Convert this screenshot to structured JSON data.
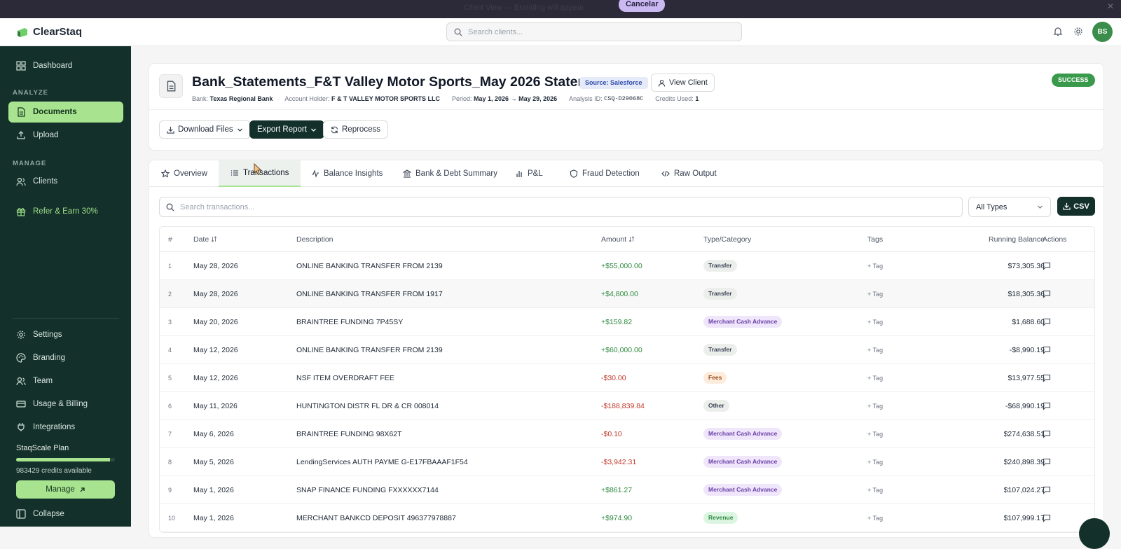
{
  "banner": {
    "message": "Client View — Branding will appear",
    "cancel_label": "Cancelar",
    "close": "✕"
  },
  "app": {
    "name": "ClearStaq",
    "search_placeholder": "Search clients...",
    "avatar_initials": "BS"
  },
  "sidebar": {
    "items": [
      {
        "label": "Dashboard",
        "icon": "grid-icon"
      }
    ],
    "analyze_label": "ANALYZE",
    "analyze_items": [
      {
        "label": "Documents",
        "icon": "document-icon",
        "active": true
      },
      {
        "label": "Upload",
        "icon": "upload-icon"
      }
    ],
    "manage_label": "MANAGE",
    "manage_items": [
      {
        "label": "Clients",
        "icon": "users-icon"
      }
    ],
    "refer_label": "Refer & Earn 30%",
    "bottom_items": [
      {
        "label": "Settings",
        "icon": "gear-icon"
      },
      {
        "label": "Branding",
        "icon": "palette-icon"
      },
      {
        "label": "Team",
        "icon": "team-icon"
      },
      {
        "label": "Usage & Billing",
        "icon": "card-icon"
      },
      {
        "label": "Integrations",
        "icon": "plug-icon"
      }
    ],
    "plan_name": "StaqScale Plan",
    "plan_usage": 0.95,
    "credits": "983429 credits available",
    "manage_label_btn": "Manage",
    "collapse_label": "Collapse"
  },
  "document": {
    "title": "Bank_Statements_F&T Valley Motor Sports_May 2026 Statement",
    "source": "Source: Salesforce",
    "view_client": "View Client",
    "status": "SUCCESS",
    "meta": {
      "bank_label": "Bank:",
      "bank": "Texas Regional Bank",
      "holder_label": "Account Holder:",
      "holder": "F & T VALLEY MOTOR SPORTS LLC",
      "period_label": "Period:",
      "period": "May 1, 2026 → May 29, 2026",
      "analysis_label": "Analysis ID:",
      "analysis_id": "CSQ-D29068C",
      "credits_label": "Credits Used:",
      "credits": "1"
    },
    "actions": {
      "download": "Download Files",
      "export": "Export Report",
      "reprocess": "Reprocess"
    }
  },
  "tabs": [
    {
      "label": "Overview",
      "icon": "star-icon"
    },
    {
      "label": "Transactions",
      "icon": "list-icon",
      "active": true
    },
    {
      "label": "Balance Insights",
      "icon": "activity-icon"
    },
    {
      "label": "Bank & Debt Summary",
      "icon": "bank-icon"
    },
    {
      "label": "P&L",
      "icon": "bar-chart-icon"
    },
    {
      "label": "Fraud Detection",
      "icon": "shield-icon"
    },
    {
      "label": "Raw Output",
      "icon": "code-icon"
    }
  ],
  "transactions": {
    "search_placeholder": "Search transactions...",
    "type_filter": "All Types",
    "csv_label": "CSV",
    "columns": {
      "num": "#",
      "date": "Date",
      "desc": "Description",
      "amount": "Amount",
      "type": "Type/Category",
      "tags": "Tags",
      "balance": "Running Balance",
      "actions": "Actions"
    },
    "tag_label": "+ Tag",
    "rows": [
      {
        "n": "1",
        "date": "May 28, 2026",
        "desc": "ONLINE BANKING TRANSFER FROM 2139",
        "amount": "+$55,000.00",
        "sign": "pos",
        "type": "Transfer",
        "kind": "transfer",
        "balance": "$73,305.36"
      },
      {
        "n": "2",
        "date": "May 28, 2026",
        "desc": "ONLINE BANKING TRANSFER FROM 1917",
        "amount": "+$4,800.00",
        "sign": "pos",
        "type": "Transfer",
        "kind": "transfer",
        "balance": "$18,305.36"
      },
      {
        "n": "3",
        "date": "May 20, 2026",
        "desc": "BRAINTREE FUNDING 7P45SY",
        "amount": "+$159.82",
        "sign": "pos",
        "type": "Merchant Cash Advance",
        "kind": "mca",
        "balance": "$1,688.60"
      },
      {
        "n": "4",
        "date": "May 12, 2026",
        "desc": "ONLINE BANKING TRANSFER FROM 2139",
        "amount": "+$60,000.00",
        "sign": "pos",
        "type": "Transfer",
        "kind": "transfer",
        "balance": "-$8,990.19"
      },
      {
        "n": "5",
        "date": "May 12, 2026",
        "desc": "NSF ITEM OVERDRAFT FEE",
        "amount": "-$30.00",
        "sign": "neg",
        "type": "Fees",
        "kind": "fees",
        "balance": "$13,977.55"
      },
      {
        "n": "6",
        "date": "May 11, 2026",
        "desc": "HUNTINGTON DISTR FL DR & CR 008014",
        "amount": "-$188,839.84",
        "sign": "neg",
        "type": "Other",
        "kind": "other",
        "balance": "-$68,990.19"
      },
      {
        "n": "7",
        "date": "May 6, 2026",
        "desc": "BRAINTREE FUNDING 98X62T",
        "amount": "-$0.10",
        "sign": "neg",
        "type": "Merchant Cash Advance",
        "kind": "mca",
        "balance": "$274,638.51"
      },
      {
        "n": "8",
        "date": "May 5, 2026",
        "desc": "LendingServices AUTH PAYME G-E17FBAAAF1F54",
        "amount": "-$3,942.31",
        "sign": "neg",
        "type": "Merchant Cash Advance",
        "kind": "mca",
        "balance": "$240,898.39"
      },
      {
        "n": "9",
        "date": "May 1, 2026",
        "desc": "SNAP FINANCE FUNDING FXXXXXX7144",
        "amount": "+$861.27",
        "sign": "pos",
        "type": "Merchant Cash Advance",
        "kind": "mca",
        "balance": "$107,024.27"
      },
      {
        "n": "10",
        "date": "May 1, 2026",
        "desc": "MERCHANT BANKCD DEPOSIT 496377978887",
        "amount": "+$974.90",
        "sign": "pos",
        "type": "Revenue",
        "kind": "revenue",
        "balance": "$107,999.17"
      }
    ]
  }
}
